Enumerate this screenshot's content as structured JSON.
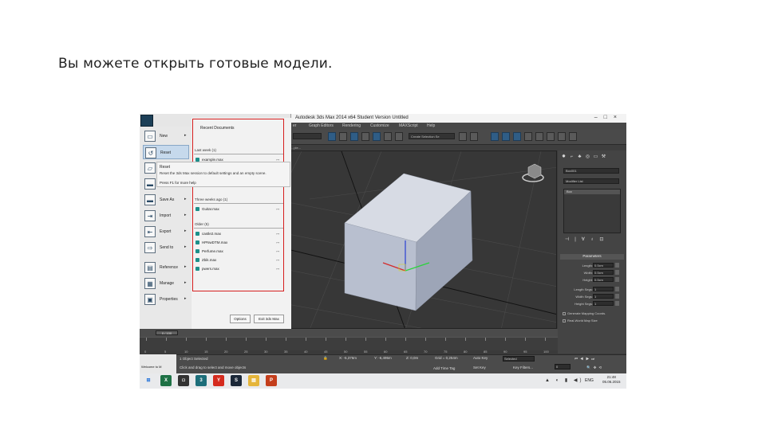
{
  "slide": {
    "title": "Вы можете открыть готовые модели."
  },
  "app": {
    "title": "Autodesk 3ds Max 2014 x64    Student Version    Untitled",
    "window_controls": [
      "–",
      "□",
      "×"
    ]
  },
  "menubar": {
    "items": [
      "er",
      "Graph Editors",
      "Rendering",
      "Customize",
      "MAXScript",
      "Help"
    ]
  },
  "toolbar": {
    "selection_set_placeholder": "Create Selection Se",
    "ribbon_label": "...ple..."
  },
  "app_menu": {
    "items": [
      {
        "label": "New",
        "icon": "new-file-icon",
        "arrow": "▸"
      },
      {
        "label": "Reset",
        "icon": "reset-icon",
        "arrow": ""
      },
      {
        "label": "Open",
        "icon": "open-folder-icon",
        "arrow": ""
      },
      {
        "label": "Save",
        "icon": "save-icon",
        "arrow": ""
      },
      {
        "label": "Save As",
        "icon": "save-as-icon",
        "arrow": "▸"
      },
      {
        "label": "Import",
        "icon": "import-icon",
        "arrow": "▸"
      },
      {
        "label": "Export",
        "icon": "export-icon",
        "arrow": "▸"
      },
      {
        "label": "Send to",
        "icon": "send-to-icon",
        "arrow": "▸"
      },
      {
        "label": "Reference",
        "icon": "reference-icon",
        "arrow": "▸"
      },
      {
        "label": "Manage",
        "icon": "manage-icon",
        "arrow": "▸"
      },
      {
        "label": "Properties",
        "icon": "properties-icon",
        "arrow": "▸"
      }
    ],
    "reset_tooltip": {
      "title": "Reset",
      "description": "Reset the 3ds Max session to default settings and an empty scene.",
      "help": "Press F1 for more help"
    },
    "recent": {
      "header": "Recent Documents",
      "groups": [
        {
          "label": "Last week (1)",
          "files": [
            "example.max"
          ]
        },
        {
          "label": "Earlier",
          "files": [
            "Big.max"
          ]
        },
        {
          "label": "Three weeks ago (1)",
          "files": [
            "Guitar.max"
          ]
        },
        {
          "label": "Older (5)",
          "files": [
            "castle2.max",
            "HPNwDTM.max",
            "Perfume.max",
            "Zbik.max",
            "pwers.max"
          ]
        }
      ]
    },
    "footer": {
      "options_label": "Options",
      "exit_label": "Exit 3ds Max"
    }
  },
  "viewport": {
    "label": "[Perspective]"
  },
  "command_panel": {
    "tabs": [
      "✸",
      "⌐",
      "♣",
      "◎",
      "▭",
      "⚒"
    ],
    "object_name": "Box001",
    "modifier_list": "Modifier List",
    "stack_item": "Box",
    "stack_icons": [
      "⊣",
      "|",
      "∀",
      "♁",
      "⊡"
    ],
    "parameters_title": "Parameters",
    "params": [
      {
        "label": "Length:",
        "value": "0.0cm"
      },
      {
        "label": "Width:",
        "value": "0.0cm"
      },
      {
        "label": "Height:",
        "value": "0.0cm"
      },
      {
        "label": "Length Segs:",
        "value": "1"
      },
      {
        "label": "Width Segs:",
        "value": "1"
      },
      {
        "label": "Height Segs:",
        "value": "1"
      }
    ],
    "checks": [
      "Generate Mapping Coords.",
      "Real-World Map Size"
    ]
  },
  "timeline": {
    "slider": "0 / 100",
    "ticks": [
      "0",
      "5",
      "10",
      "15",
      "20",
      "25",
      "30",
      "35",
      "40",
      "45",
      "50",
      "55",
      "60",
      "65",
      "70",
      "75",
      "80",
      "85",
      "90",
      "95",
      "100"
    ]
  },
  "statusbar": {
    "welcome": "Welcome to M",
    "selection": "1 Object Selected",
    "prompt": "Click and drag to select and move objects",
    "x": "X: -5,376m",
    "y": "Y: -6,495m",
    "z": "Z: 0,0m",
    "grid": "Grid = 0,254m",
    "add_time_tag": "Add Time Tag",
    "auto_key": "Auto Key",
    "selected": "Selected",
    "set_key": "Set Key",
    "key_filters": "Key Filters...",
    "frame": "0"
  },
  "taskbar": {
    "apps": [
      {
        "name": "windows-start-icon",
        "glyph": "⊞",
        "color": "#e9eaec"
      },
      {
        "name": "excel-icon",
        "glyph": "X",
        "color": "#1e7145"
      },
      {
        "name": "camera-icon",
        "glyph": "◘",
        "color": "#333333"
      },
      {
        "name": "3dsmax-icon",
        "glyph": "3",
        "color": "#1d6e7a"
      },
      {
        "name": "yandex-browser-icon",
        "glyph": "Y",
        "color": "#d52b1e"
      },
      {
        "name": "steam-icon",
        "glyph": "S",
        "color": "#1b2838"
      },
      {
        "name": "file-explorer-icon",
        "glyph": "▤",
        "color": "#e5b53a"
      },
      {
        "name": "powerpoint-icon",
        "glyph": "P",
        "color": "#c43e1c"
      }
    ],
    "language": "ENG",
    "time": "21:48",
    "date": "05.06.2015"
  }
}
